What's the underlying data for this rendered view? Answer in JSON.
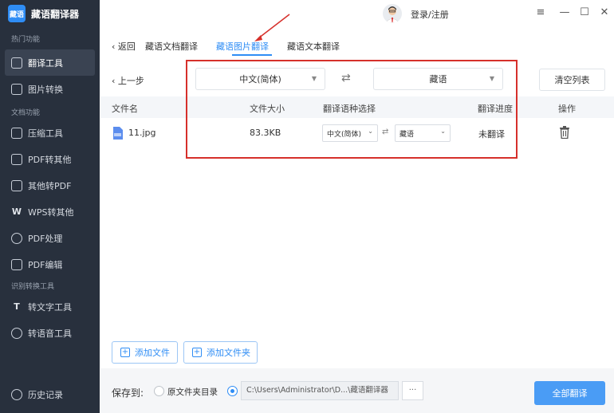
{
  "app": {
    "logo_text": "藏语",
    "title": "藏语翻译器"
  },
  "header": {
    "login": "登录/注册",
    "menu_icon": "≡",
    "min_icon": "—",
    "max_icon": "☐",
    "close_icon": "✕"
  },
  "sidebar": {
    "sections": [
      {
        "label": "热门功能"
      },
      {
        "label": "文档功能"
      },
      {
        "label": "识别转换工具"
      }
    ],
    "items": [
      {
        "label": "翻译工具"
      },
      {
        "label": "图片转换"
      },
      {
        "label": "压缩工具"
      },
      {
        "label": "PDF转其他"
      },
      {
        "label": "其他转PDF"
      },
      {
        "label": "WPS转其他"
      },
      {
        "label": "PDF处理"
      },
      {
        "label": "PDF编辑"
      },
      {
        "label": "转文字工具"
      },
      {
        "label": "转语音工具"
      }
    ],
    "history": "历史记录"
  },
  "tabs": {
    "back": "返回",
    "items": [
      {
        "label": "藏语文档翻译"
      },
      {
        "label": "藏语图片翻译"
      },
      {
        "label": "藏语文本翻译"
      }
    ]
  },
  "toolbar": {
    "prev": "上一步",
    "source_lang": "中文(简体)",
    "target_lang": "藏语",
    "swap_icon": "⇄",
    "clear": "清空列表"
  },
  "table": {
    "headers": [
      "文件名",
      "文件大小",
      "翻译语种选择",
      "翻译进度",
      "操作"
    ],
    "rows": [
      {
        "name": "11.jpg",
        "size": "83.3KB",
        "src": "中文(简体)",
        "dst": "藏语",
        "progress": "未翻译"
      }
    ]
  },
  "actions": {
    "add_file": "添加文件",
    "add_folder": "添加文件夹"
  },
  "bottom": {
    "save_to": "保存到:",
    "option_original": "原文件夹目录",
    "path": "C:\\Users\\Administrator\\D...\\藏语翻译器",
    "browse": "···",
    "translate_all": "全部翻译"
  },
  "colors": {
    "accent": "#2f8df5",
    "sidebar_bg": "#28303d",
    "annotation_red": "#d6302b"
  }
}
